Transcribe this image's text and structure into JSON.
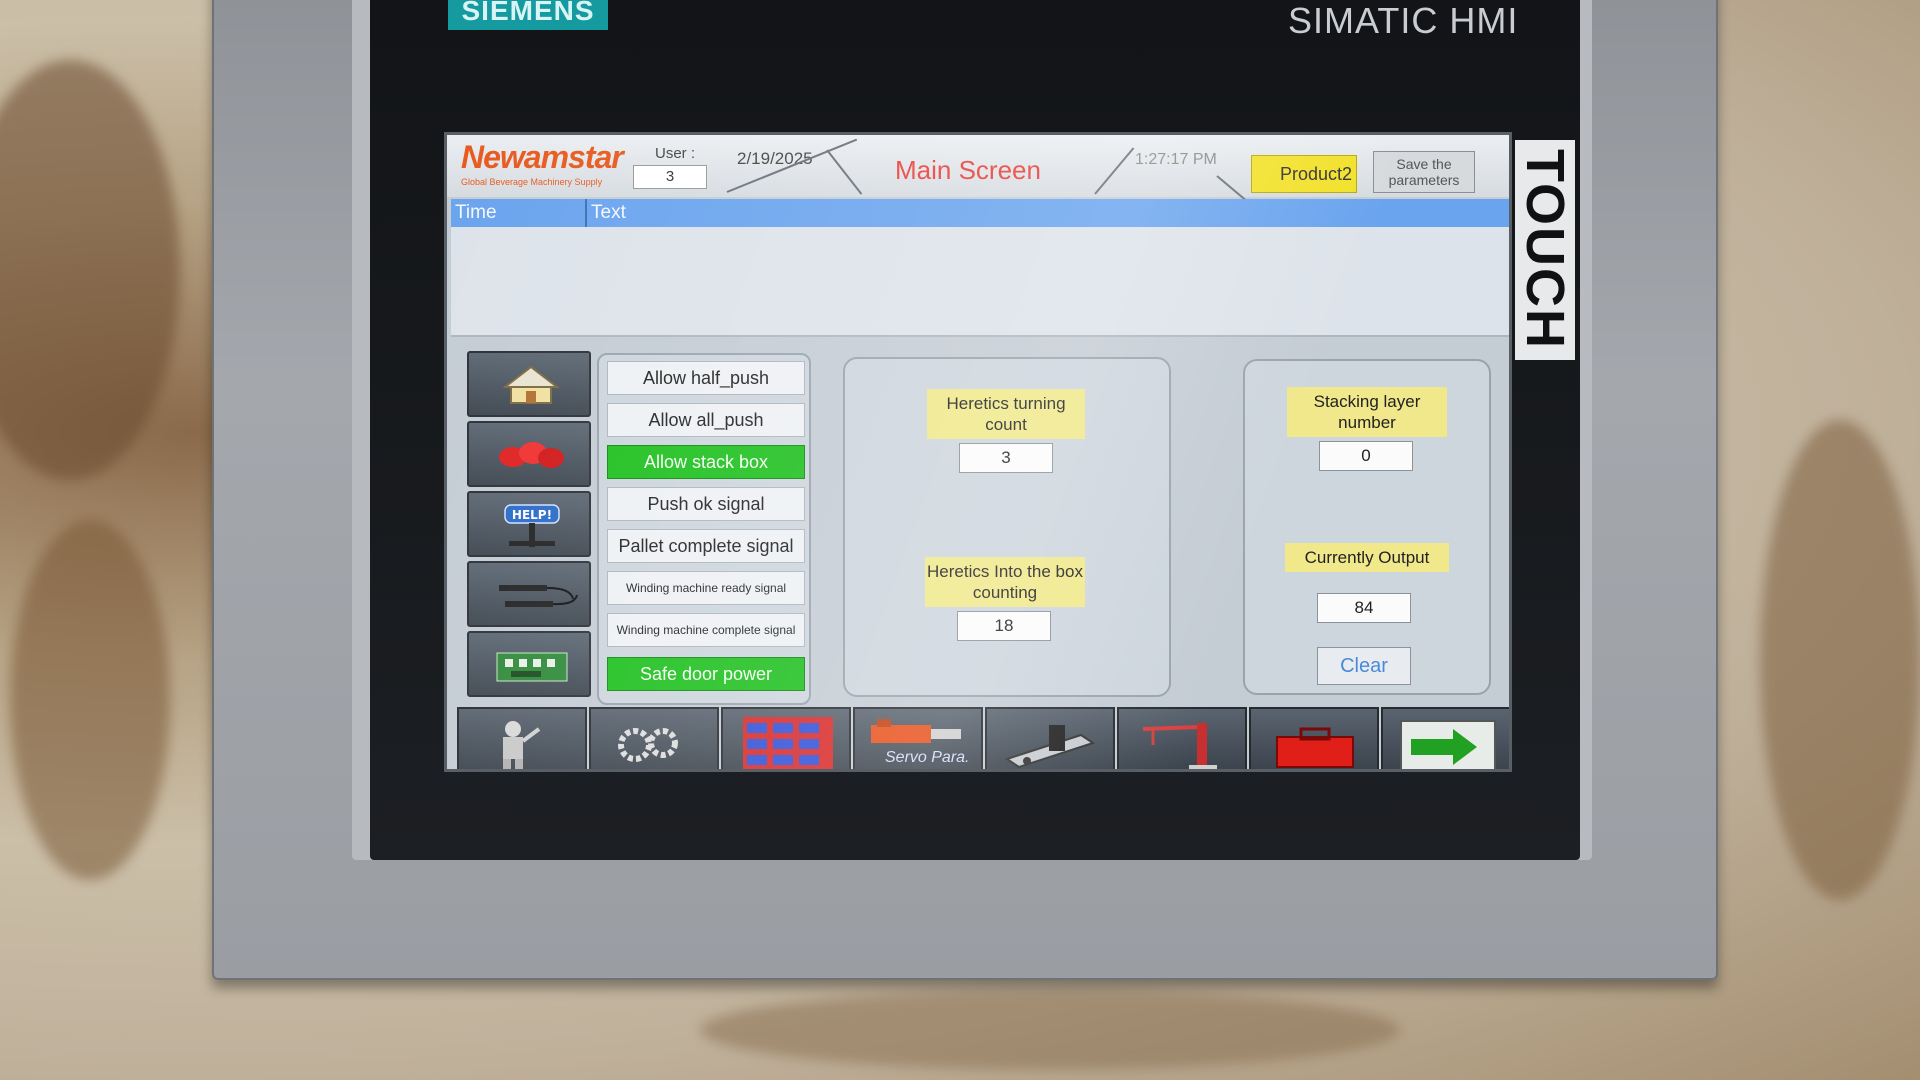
{
  "device": {
    "brand": "SIEMENS",
    "model": "SIMATIC HMI",
    "touch_label": "TOUCH"
  },
  "header": {
    "logo": "Newamstar",
    "logo_subtitle": "Global Beverage Machinery Supply",
    "user_label": "User :",
    "user_value": "3",
    "date": "2/19/2025",
    "title": "Main Screen",
    "time": "1:27:17 PM",
    "product": "Product2",
    "save_button": "Save the parameters"
  },
  "alarm_view": {
    "col_time": "Time",
    "col_text": "Text"
  },
  "nav": [
    {
      "name": "home-icon"
    },
    {
      "name": "alarm-lights-icon"
    },
    {
      "name": "help-icon",
      "label": "HELP!"
    },
    {
      "name": "sensors-icon"
    },
    {
      "name": "io-board-icon"
    }
  ],
  "signals": [
    {
      "label": "Allow half_push",
      "active": false
    },
    {
      "label": "Allow all_push",
      "active": false
    },
    {
      "label": "Allow stack box",
      "active": true
    },
    {
      "label": "Push ok signal",
      "active": false
    },
    {
      "label": "Pallet complete signal",
      "active": false
    },
    {
      "label": "Winding machine ready signal",
      "active": false
    },
    {
      "label": "Winding machine complete signal",
      "active": false
    },
    {
      "label": "Safe door power",
      "active": true
    }
  ],
  "counters": {
    "turning_label": "Heretics turning count",
    "turning_value": "3",
    "into_box_label": "Heretics Into the box counting",
    "into_box_value": "18",
    "stacking_label": "Stacking layer number",
    "stacking_value": "0",
    "output_label": "Currently Output",
    "output_value": "84",
    "clear_button": "Clear"
  },
  "toolbar": [
    {
      "name": "operator-icon"
    },
    {
      "name": "gears-icon"
    },
    {
      "name": "pallet-pattern-icon"
    },
    {
      "name": "servo-params-icon",
      "label": "Servo Para."
    },
    {
      "name": "conveyor-icon"
    },
    {
      "name": "robot-arm-icon"
    },
    {
      "name": "toolbox-icon"
    },
    {
      "name": "next-screen-icon"
    }
  ],
  "colors": {
    "signal_on": "#1ec01e",
    "label_yellow": "#f0e88a",
    "title_red": "#e8403a",
    "alarm_header_blue": "#6aa4ee",
    "product_yellow": "#f2e12a"
  }
}
